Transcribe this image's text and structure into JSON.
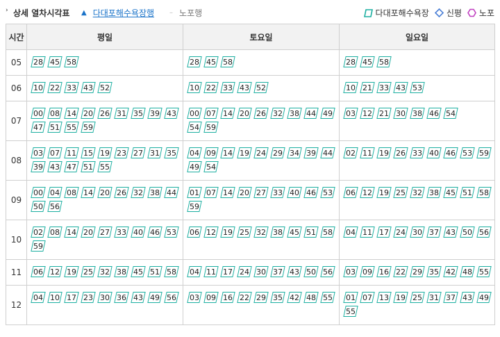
{
  "header": {
    "title": "상세 열차시각표",
    "directions": [
      {
        "label": "다대포해수욕장행",
        "active": true
      },
      {
        "label": "노포행",
        "active": false
      }
    ],
    "legend": [
      {
        "label": "다대포해수욕장",
        "shape": "parallelogram",
        "color": "#1aaea0"
      },
      {
        "label": "신평",
        "shape": "diamond",
        "color": "#4a7fd6"
      },
      {
        "label": "노포",
        "shape": "hexagon",
        "color": "#c03fc0"
      }
    ]
  },
  "table": {
    "columns": [
      "시간",
      "평일",
      "토요일",
      "일요일"
    ],
    "rows": [
      {
        "hour": "05",
        "weekday": [
          "28",
          "45",
          "58"
        ],
        "saturday": [
          "28",
          "45",
          "58"
        ],
        "sunday": [
          "28",
          "45",
          "58"
        ]
      },
      {
        "hour": "06",
        "weekday": [
          "10",
          "22",
          "33",
          "43",
          "52"
        ],
        "saturday": [
          "10",
          "22",
          "33",
          "43",
          "52"
        ],
        "sunday": [
          "10",
          "21",
          "33",
          "43",
          "53"
        ]
      },
      {
        "hour": "07",
        "weekday": [
          "00",
          "08",
          "14",
          "20",
          "26",
          "31",
          "35",
          "39",
          "43",
          "47",
          "51",
          "55",
          "59"
        ],
        "saturday": [
          "00",
          "07",
          "14",
          "20",
          "26",
          "32",
          "38",
          "44",
          "49",
          "54",
          "59"
        ],
        "sunday": [
          "03",
          "12",
          "21",
          "30",
          "38",
          "46",
          "54"
        ]
      },
      {
        "hour": "08",
        "weekday": [
          "03",
          "07",
          "11",
          "15",
          "19",
          "23",
          "27",
          "31",
          "35",
          "39",
          "43",
          "47",
          "51",
          "55"
        ],
        "saturday": [
          "04",
          "09",
          "14",
          "19",
          "24",
          "29",
          "34",
          "39",
          "44",
          "49",
          "54"
        ],
        "sunday": [
          "02",
          "11",
          "19",
          "26",
          "33",
          "40",
          "46",
          "53",
          "59"
        ]
      },
      {
        "hour": "09",
        "weekday": [
          "00",
          "04",
          "08",
          "14",
          "20",
          "26",
          "32",
          "38",
          "44",
          "50",
          "56"
        ],
        "saturday": [
          "01",
          "07",
          "14",
          "20",
          "27",
          "33",
          "40",
          "46",
          "53",
          "59"
        ],
        "sunday": [
          "06",
          "12",
          "19",
          "25",
          "32",
          "38",
          "45",
          "51",
          "58"
        ]
      },
      {
        "hour": "10",
        "weekday": [
          "02",
          "08",
          "14",
          "20",
          "27",
          "33",
          "40",
          "46",
          "53",
          "59"
        ],
        "saturday": [
          "06",
          "12",
          "19",
          "25",
          "32",
          "38",
          "45",
          "51",
          "58"
        ],
        "sunday": [
          "04",
          "11",
          "17",
          "24",
          "30",
          "37",
          "43",
          "50",
          "56"
        ]
      },
      {
        "hour": "11",
        "weekday": [
          "06",
          "12",
          "19",
          "25",
          "32",
          "38",
          "45",
          "51",
          "58"
        ],
        "saturday": [
          "04",
          "11",
          "17",
          "24",
          "30",
          "37",
          "43",
          "50",
          "56"
        ],
        "sunday": [
          "03",
          "09",
          "16",
          "22",
          "29",
          "35",
          "42",
          "48",
          "55"
        ]
      },
      {
        "hour": "12",
        "weekday": [
          "04",
          "10",
          "17",
          "23",
          "30",
          "36",
          "43",
          "49",
          "56"
        ],
        "saturday": [
          "03",
          "09",
          "16",
          "22",
          "29",
          "35",
          "42",
          "48",
          "55"
        ],
        "sunday": [
          "01",
          "07",
          "13",
          "19",
          "25",
          "31",
          "37",
          "43",
          "49",
          "55"
        ]
      }
    ]
  }
}
